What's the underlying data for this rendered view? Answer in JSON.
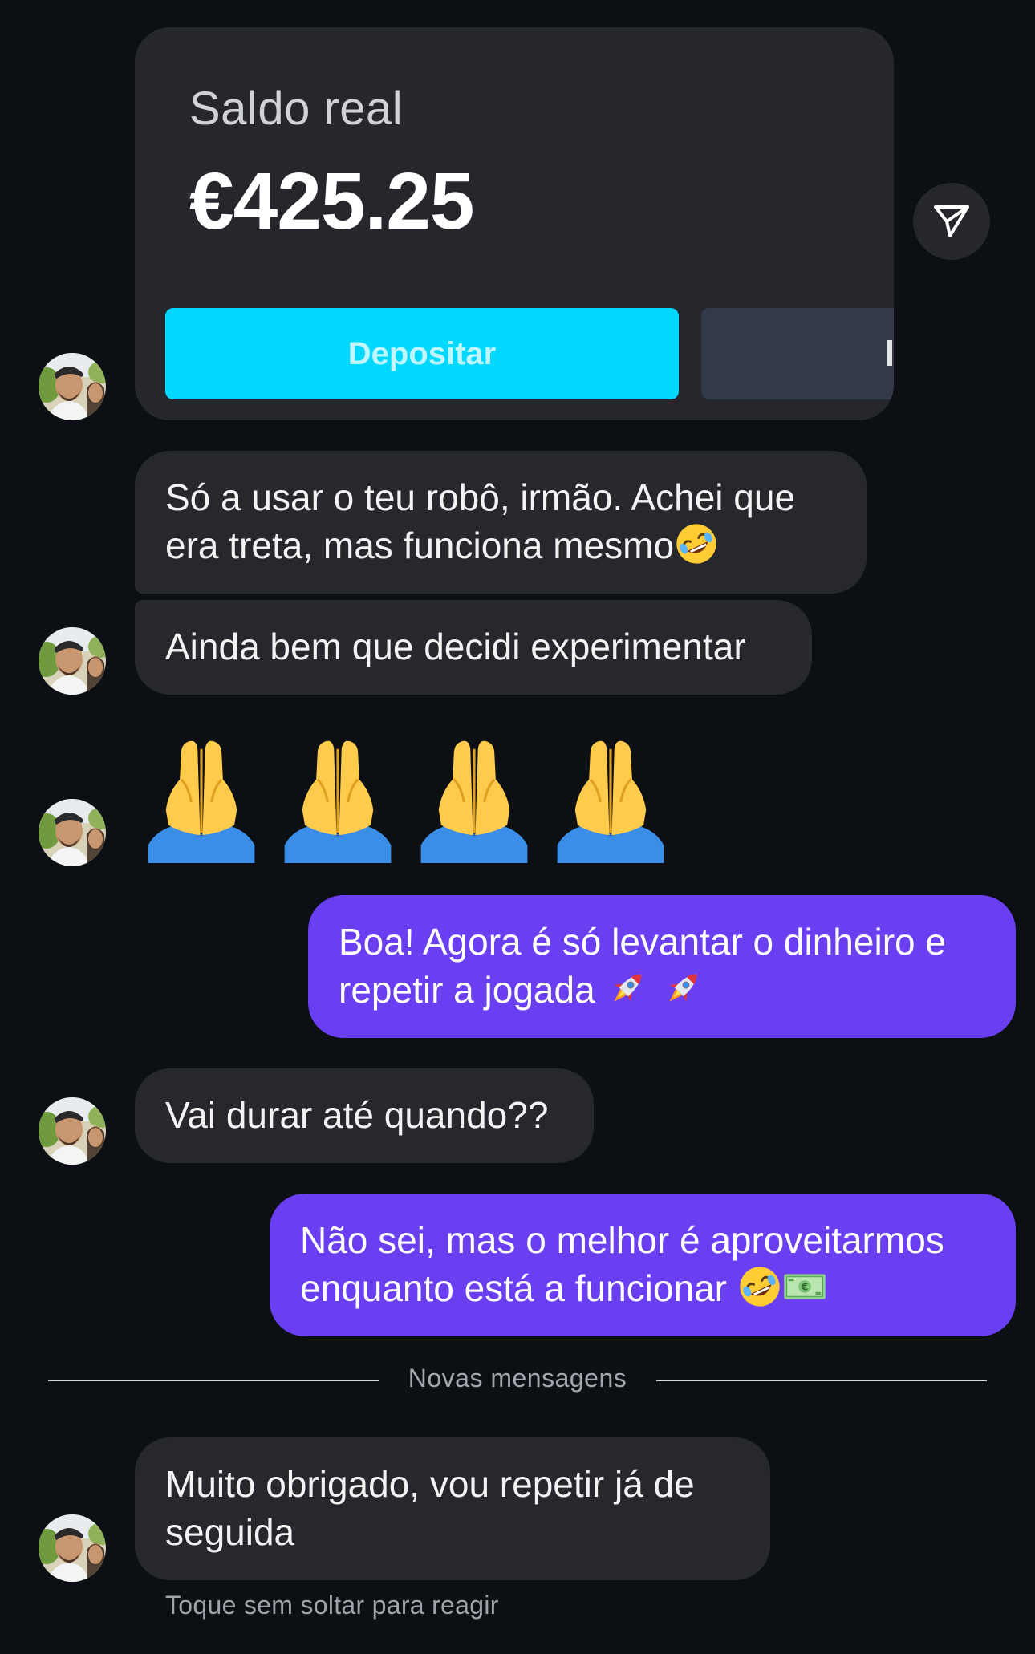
{
  "shared_card": {
    "label": "Saldo real",
    "amount": "€425.25",
    "deposit_label": "Depositar",
    "second_button_label": ""
  },
  "messages": [
    {
      "id": "m1",
      "side": "incoming",
      "text": "Só a usar o teu robô, irmão. Achei que era treta, mas funciona mesmo",
      "emoji": [
        "rolling-on-floor-laughing"
      ]
    },
    {
      "id": "m2",
      "side": "incoming",
      "text": "Ainda bem que decidi experimentar"
    },
    {
      "id": "m3",
      "side": "incoming",
      "emoji_only": [
        "folded-hands",
        "folded-hands",
        "folded-hands",
        "folded-hands"
      ]
    },
    {
      "id": "m4",
      "side": "outgoing",
      "line1": "Boa! Agora é só levantar o dinheiro e",
      "line2": "repetir a jogada",
      "emoji": [
        "rocket",
        "rocket"
      ]
    },
    {
      "id": "m5",
      "side": "incoming",
      "text": "Vai durar até quando??"
    },
    {
      "id": "m6",
      "side": "outgoing",
      "line1": "Não sei, mas o melhor é aproveitarmos",
      "line2": "enquanto está a funcionar",
      "emoji": [
        "rolling-on-floor-laughing",
        "euro-banknote"
      ]
    },
    {
      "id": "m7",
      "side": "incoming",
      "line1": "Muito obrigado, vou repetir já de",
      "line2": "seguida"
    }
  ],
  "divider": {
    "label": "Novas mensagens"
  },
  "hint": "Toque sem soltar para reagir",
  "colors": {
    "background": "#0c1014",
    "incoming_bubble": "#26282d",
    "outgoing_bubble": "#6a3ff2",
    "deposit_button": "#00d8ff"
  }
}
